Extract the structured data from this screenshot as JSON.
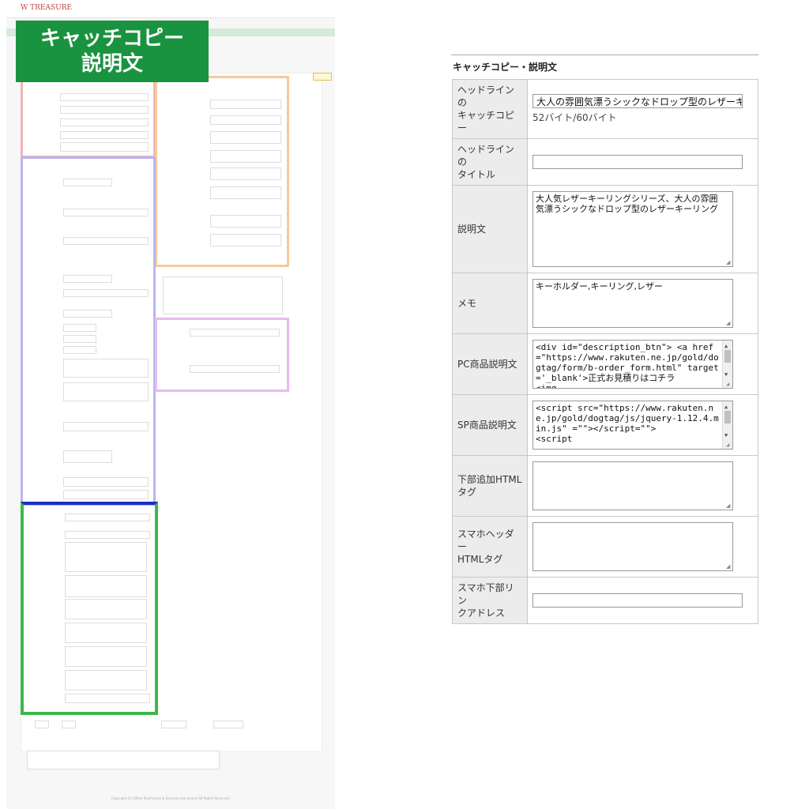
{
  "banner": {
    "line1": "キャッチコピー",
    "line2": "説明文"
  },
  "highlight_colors": {
    "red": "#f4b4b4",
    "orange": "#f7c99a",
    "blue": "#b7b7f0",
    "purple": "#e8b9ef",
    "green": "#3db84a",
    "dark_blue": "#1a2fbf"
  },
  "mini": {
    "logo": "W TREASURE",
    "copyright": "Copyright (C) Office Riverhouse & Services net service All Rights Reserved."
  },
  "section_title": "キャッチコピー・説明文",
  "rows": [
    {
      "label": "ヘッドラインの\nキャッチコピー",
      "value": "大人の雰囲気漂うシックなドロップ型のレザーキー",
      "bytes": "52バイト/60バイト"
    },
    {
      "label": "ヘッドラインの\nタイトル",
      "value": ""
    },
    {
      "label": "説明文",
      "value": "大人気レザーキーリングシリーズ、大人の雰囲気漂うシックなドロップ型のレザーキーリング"
    },
    {
      "label": "メモ",
      "value": "キーホルダー,キーリング,レザー"
    },
    {
      "label": "PC商品説明文",
      "value": "<div id=\"description_btn\"> <a href=\"https://www.rakuten.ne.jp/gold/dogtag/form/b-order_form.html\" target='_blank'>正式お見積りはコチラ\n<img"
    },
    {
      "label": "SP商品説明文",
      "value": "<script src=\"https://www.rakuten.ne.jp/gold/dogtag/js/jquery-1.12.4.min.js\" =\"\"></script=\"\">\n<script"
    },
    {
      "label": "下部追加HTML\nタグ",
      "value": ""
    },
    {
      "label": "スマホヘッダー\nHTMLタグ",
      "value": ""
    },
    {
      "label": "スマホ下部リン\nクアドレス",
      "value": ""
    }
  ]
}
